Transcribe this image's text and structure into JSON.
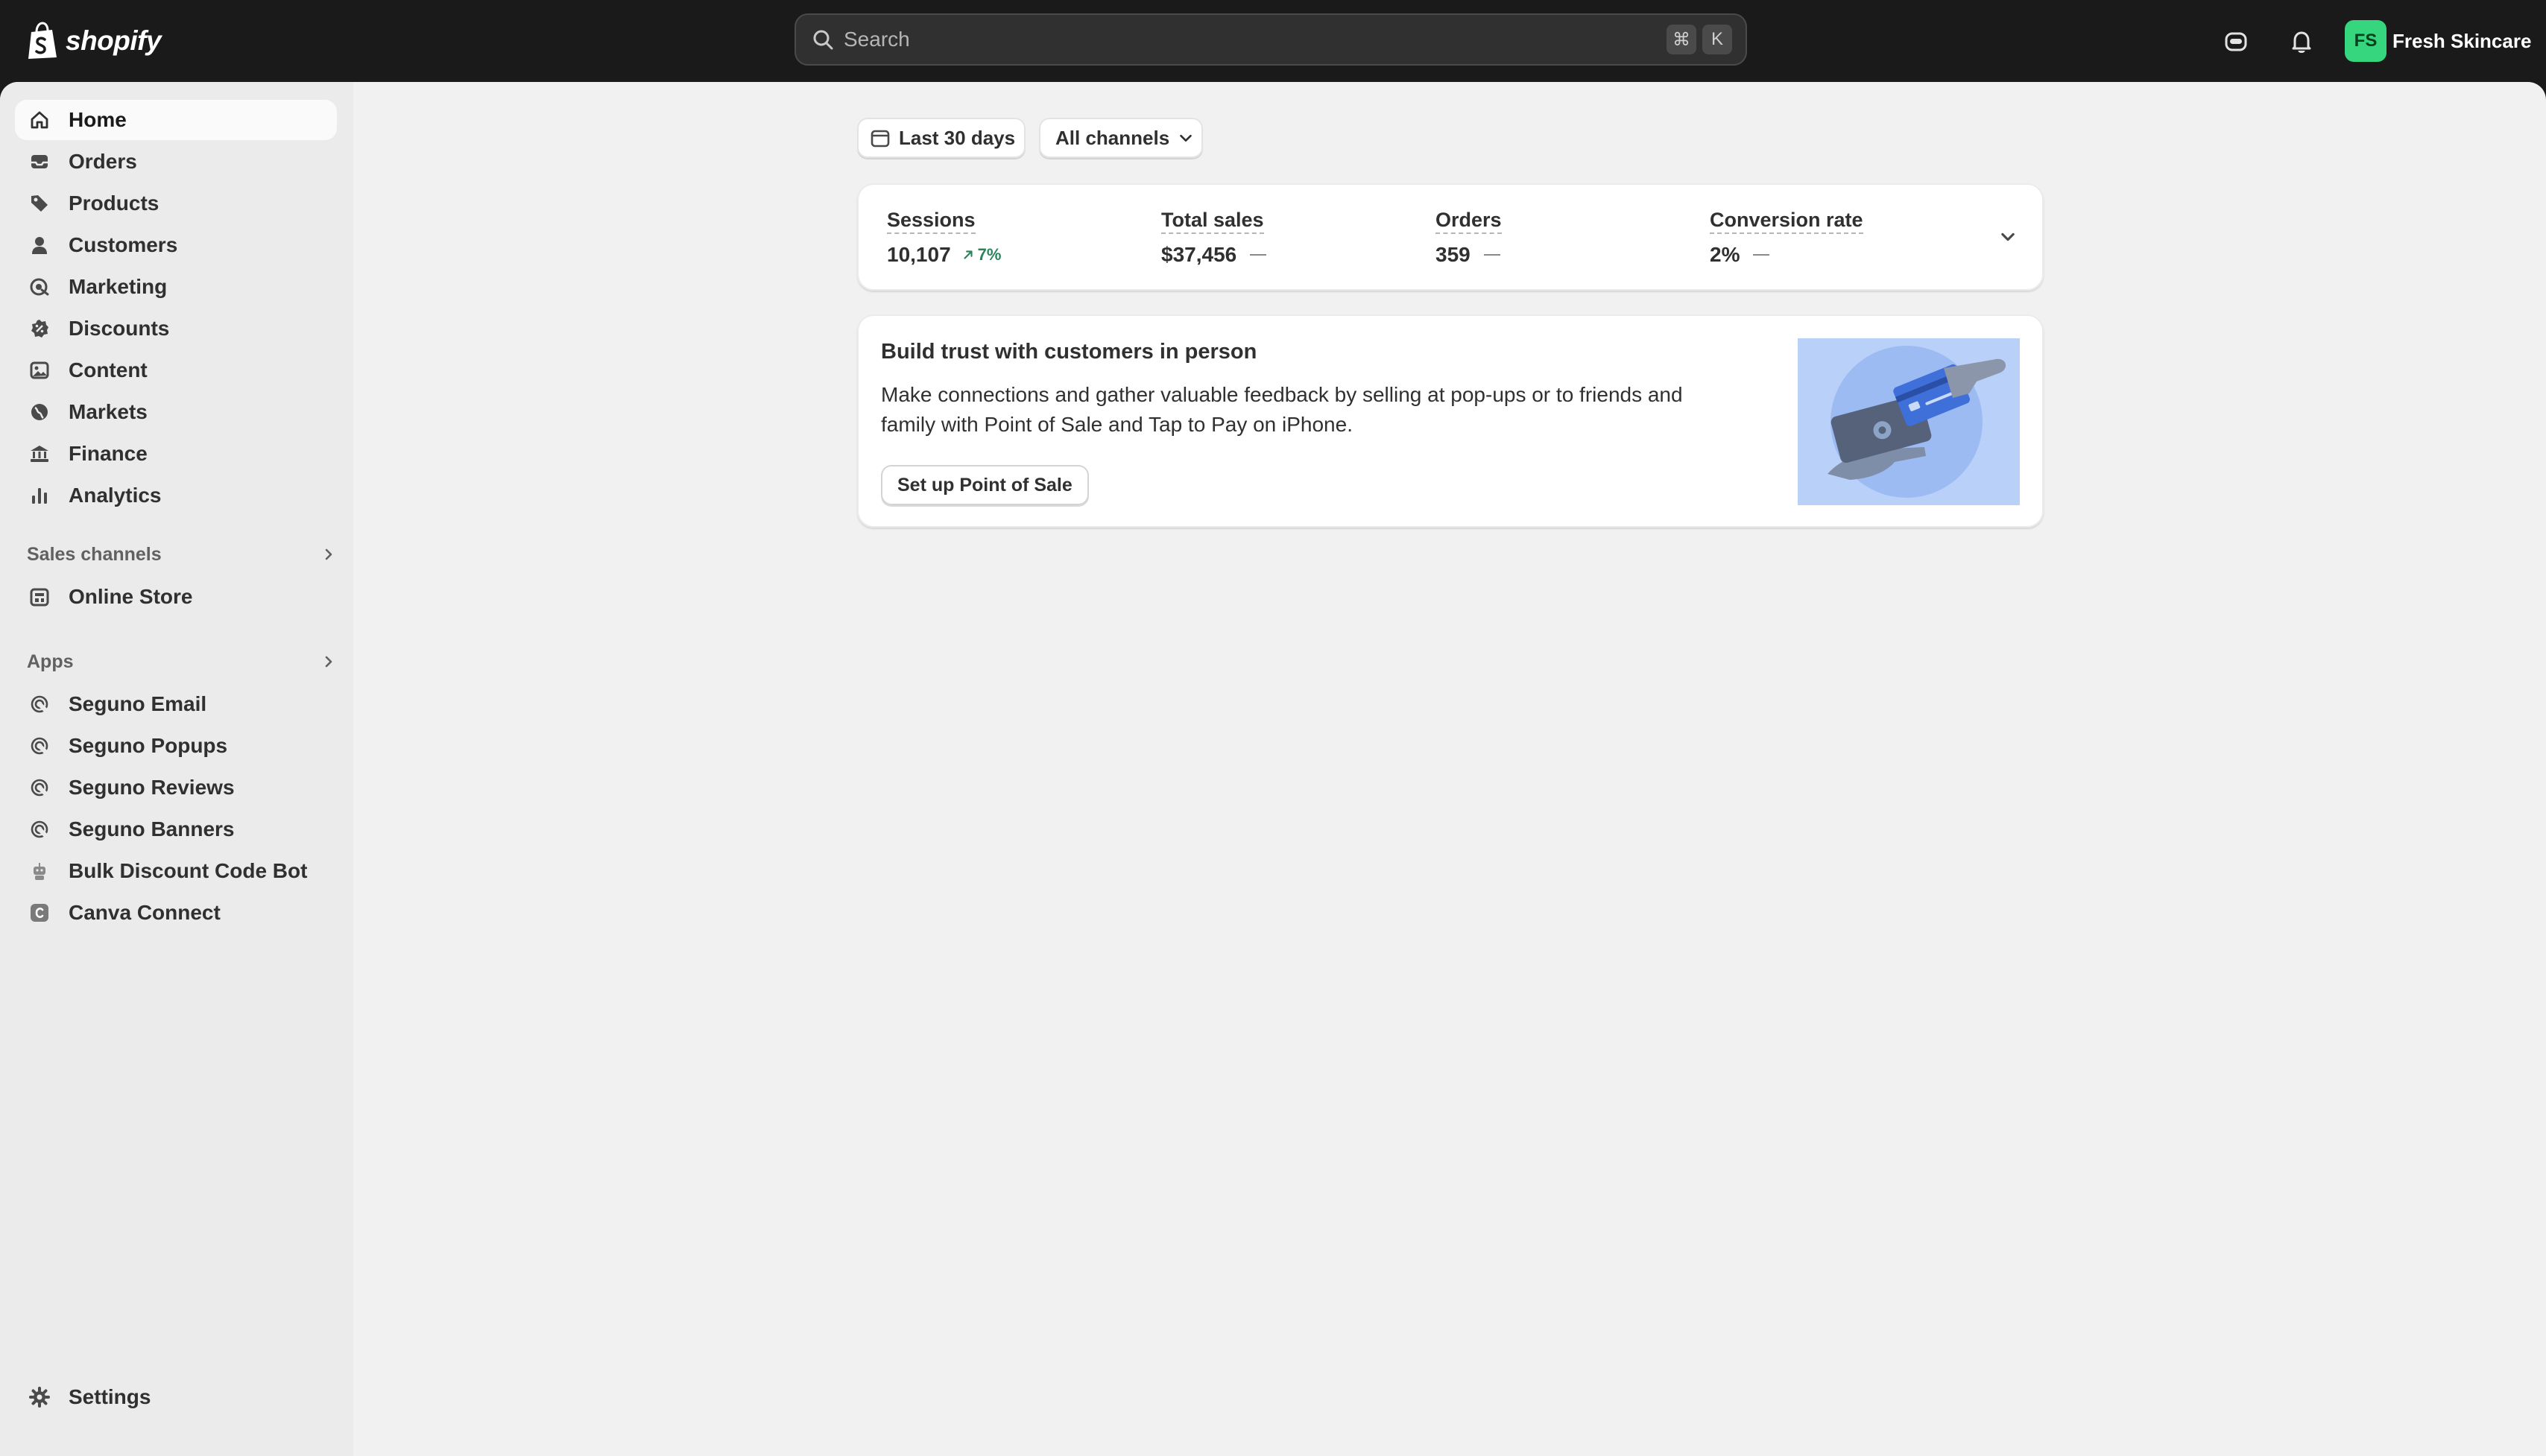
{
  "brand": {
    "wordmark": "shopify",
    "icon": "shopify-bag-icon"
  },
  "search": {
    "placeholder": "Search",
    "shortcut_keys": [
      "⌘",
      "K"
    ]
  },
  "topbar": {
    "store_avatar_initials": "FS",
    "store_name": "Fresh Skincare",
    "icons": [
      "sidekick-icon",
      "bell-icon"
    ]
  },
  "sidebar": {
    "items": [
      {
        "label": "Home",
        "icon": "home-icon",
        "active": true
      },
      {
        "label": "Orders",
        "icon": "inbox-icon"
      },
      {
        "label": "Products",
        "icon": "tag-icon"
      },
      {
        "label": "Customers",
        "icon": "person-icon"
      },
      {
        "label": "Marketing",
        "icon": "target-icon"
      },
      {
        "label": "Discounts",
        "icon": "discount-icon"
      },
      {
        "label": "Content",
        "icon": "image-icon"
      },
      {
        "label": "Markets",
        "icon": "globe-icon"
      },
      {
        "label": "Finance",
        "icon": "bank-icon"
      },
      {
        "label": "Analytics",
        "icon": "bar-chart-icon"
      }
    ],
    "sales_channels_heading": "Sales channels",
    "sales_channels": [
      {
        "label": "Online Store",
        "icon": "store-icon"
      }
    ],
    "apps_heading": "Apps",
    "apps": [
      {
        "label": "Seguno Email",
        "icon": "seguno-icon"
      },
      {
        "label": "Seguno Popups",
        "icon": "seguno-icon"
      },
      {
        "label": "Seguno Reviews",
        "icon": "seguno-icon"
      },
      {
        "label": "Seguno Banners",
        "icon": "seguno-icon"
      },
      {
        "label": "Bulk Discount Code Bot",
        "icon": "robot-icon"
      },
      {
        "label": "Canva Connect",
        "icon": "canva-icon"
      }
    ],
    "settings": {
      "label": "Settings",
      "icon": "gear-icon"
    }
  },
  "filters": {
    "date_range": "Last 30 days",
    "channel": "All channels"
  },
  "metrics": [
    {
      "label": "Sessions",
      "value": "10,107",
      "delta": "7%",
      "trend": "up"
    },
    {
      "label": "Total sales",
      "value": "$37,456",
      "trend": "none"
    },
    {
      "label": "Orders",
      "value": "359",
      "trend": "none"
    },
    {
      "label": "Conversion rate",
      "value": "2%",
      "trend": "none"
    }
  ],
  "promo": {
    "title": "Build trust with customers in person",
    "body": "Make connections and gather valuable feedback by selling at pop-ups or to friends and family with Point of Sale and Tap to Pay on iPhone.",
    "button": "Set up Point of Sale"
  },
  "colors": {
    "topbar": "#1a1a1a",
    "frame": "#f1f1f1",
    "sidebar": "#ebebeb",
    "positive": "#29845a",
    "avatar": "#36d67e",
    "illustration_bg": "#b9d0f9"
  }
}
